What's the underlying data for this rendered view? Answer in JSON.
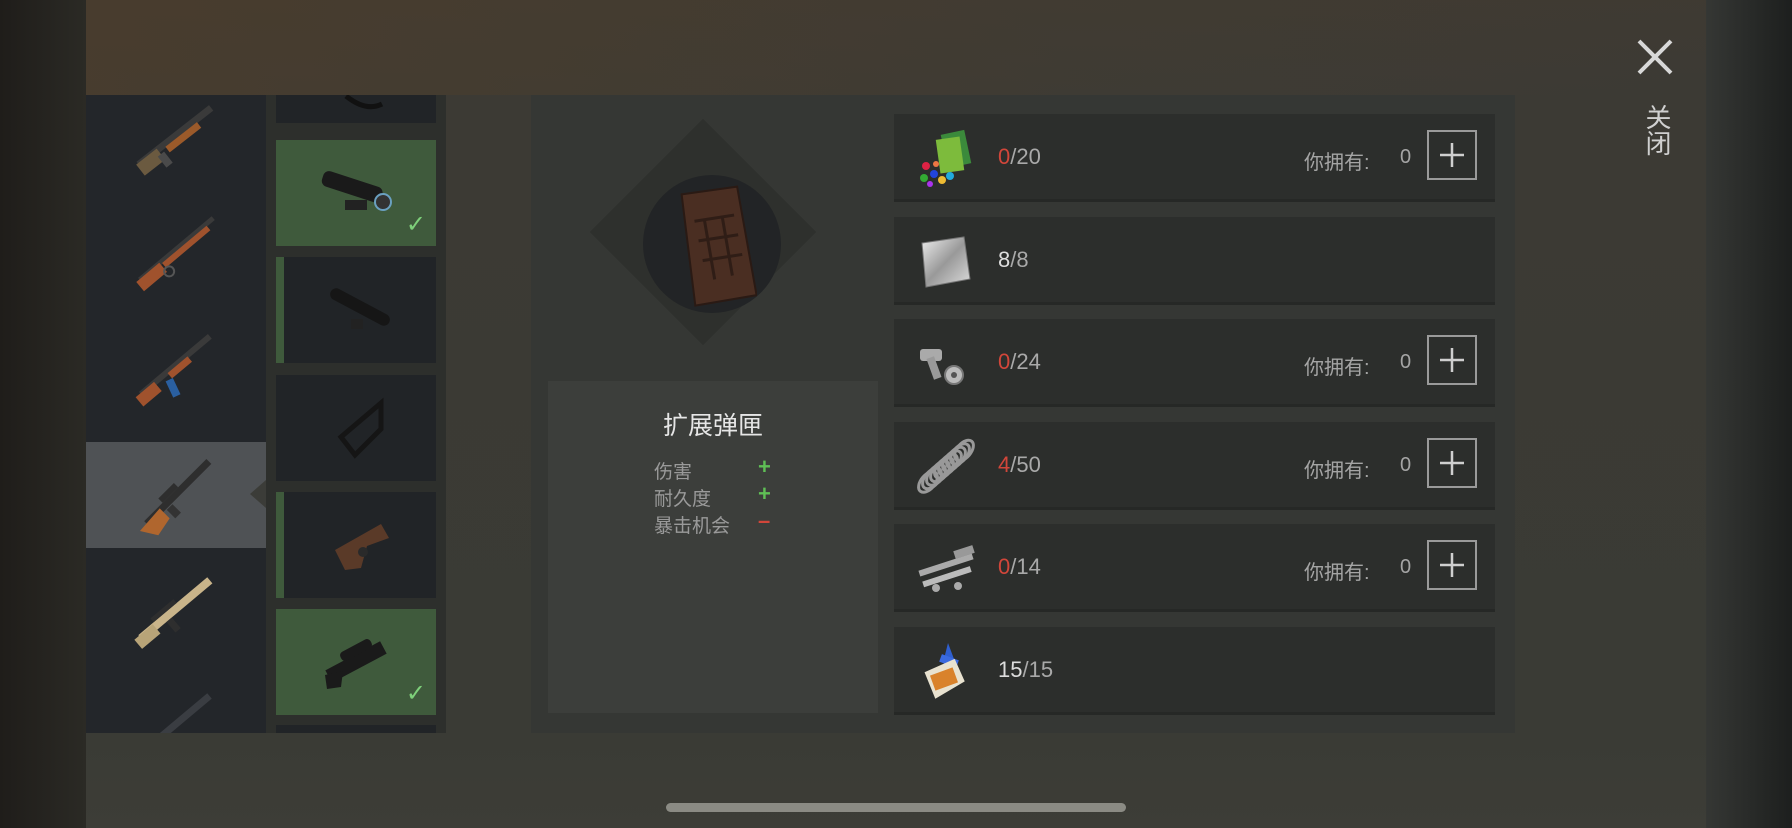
{
  "close": {
    "label": "关闭",
    "icon": "close-icon"
  },
  "weapons": [
    {
      "name": "pump-shotgun"
    },
    {
      "name": "lever-rifle"
    },
    {
      "name": "assault-rifle-ak"
    },
    {
      "name": "sniper-rifle-vss",
      "selected": true
    },
    {
      "name": "rifle-scar"
    },
    {
      "name": "rifle-partial"
    }
  ],
  "attachments": [
    {
      "name": "attachment-top-partial"
    },
    {
      "name": "scope",
      "equipped": true
    },
    {
      "name": "silencer",
      "marked": true
    },
    {
      "name": "stock-frame"
    },
    {
      "name": "stock-wooden",
      "marked": true
    },
    {
      "name": "scoped-receiver",
      "equipped": true
    }
  ],
  "item": {
    "name": "扩展弹匣",
    "stats": [
      {
        "label": "伤害",
        "sign": "+",
        "color": "#5fbf55"
      },
      {
        "label": "耐久度",
        "sign": "+",
        "color": "#5fbf55"
      },
      {
        "label": "暴击机会",
        "sign": "–",
        "color": "#d1463a"
      }
    ]
  },
  "requirements": [
    {
      "icon": "plastic-parts-icon",
      "current": "0",
      "sep": "/",
      "required": "20",
      "lacking": true,
      "own_label": "你拥有:",
      "own": "0"
    },
    {
      "icon": "metal-sheet-icon",
      "current": "8",
      "sep": "/",
      "required": "8",
      "lacking": false
    },
    {
      "icon": "bolts-nuts-icon",
      "current": "0",
      "sep": "/",
      "required": "24",
      "lacking": true,
      "own_label": "你拥有:",
      "own": "0"
    },
    {
      "icon": "spring-icon",
      "current": "4",
      "sep": "/",
      "required": "50",
      "lacking": true,
      "own_label": "你拥有:",
      "own": "0"
    },
    {
      "icon": "pipe-parts-icon",
      "current": "0",
      "sep": "/",
      "required": "14",
      "lacking": true,
      "own_label": "你拥有:",
      "own": "0"
    },
    {
      "icon": "glue-icon",
      "current": "15",
      "sep": "/",
      "required": "15",
      "lacking": false
    }
  ],
  "colors": {
    "lack": "#d1463a",
    "positive": "#5fbf55",
    "equipped": "#3f5a3c"
  }
}
